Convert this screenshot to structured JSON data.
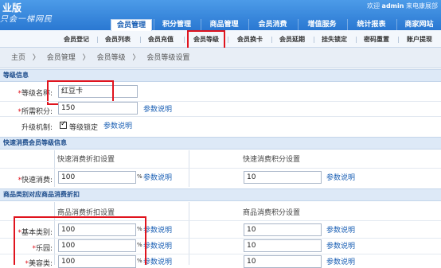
{
  "header": {
    "logo": "业版",
    "slogan": "只会一梯网民",
    "welcome_prefix": "欢迎",
    "username": "admin",
    "welcome_suffix": "来电康展部"
  },
  "main_tabs": [
    {
      "label": "会员管理",
      "active": true
    },
    {
      "label": "积分管理",
      "active": false
    },
    {
      "label": "商品管理",
      "active": false
    },
    {
      "label": "会员消费",
      "active": false
    },
    {
      "label": "增值服务",
      "active": false
    },
    {
      "label": "统计报表",
      "active": false
    },
    {
      "label": "商家网站",
      "active": false
    }
  ],
  "sub_tabs": [
    {
      "label": "会员登记",
      "active": false
    },
    {
      "label": "会员列表",
      "active": false
    },
    {
      "label": "会员充值",
      "active": false
    },
    {
      "label": "会员等级",
      "active": true
    },
    {
      "label": "会员换卡",
      "active": false
    },
    {
      "label": "会员延期",
      "active": false
    },
    {
      "label": "挂失锁定",
      "active": false
    },
    {
      "label": "密码重置",
      "active": false
    },
    {
      "label": "账户提现",
      "active": false
    }
  ],
  "breadcrumb": [
    "主页",
    "〉",
    "会员管理",
    "〉",
    "会员等级",
    "〉",
    "会员等级设置"
  ],
  "level_info": {
    "title": "等级信息",
    "name_label": "等级名称:",
    "name_value": "红豆卡",
    "points_label": "所需积分:",
    "points_value": "150",
    "points_help": "参数说明",
    "upgrade_label": "升级机制:",
    "upgrade_checked": true,
    "upgrade_option": "等级锁定",
    "upgrade_help": "参数说明"
  },
  "quick": {
    "title": "快速消费会员等级信息",
    "col_discount": "快速消费折扣设置",
    "col_points": "快速消费积分设置",
    "row_label": "快速消费:",
    "discount_value": "100",
    "percent": "%",
    "discount_help": "参数说明",
    "points_value": "10",
    "points_help": "参数说明"
  },
  "category": {
    "title": "商品类别对应商品消费折扣",
    "col_discount": "商品消费折扣设置",
    "col_points": "商品消费积分设置",
    "percent": "%",
    "rows": [
      {
        "label": "基本类别:",
        "discount": "100",
        "discount_help": "参数说明",
        "points": "10",
        "points_help": "参数说明"
      },
      {
        "label": "乐园:",
        "discount": "100",
        "discount_help": "参数说明",
        "points": "10",
        "points_help": "参数说明"
      },
      {
        "label": "美容类:",
        "discount": "100",
        "discount_help": "参数说明",
        "points": "10",
        "points_help": "参数说明"
      }
    ]
  }
}
